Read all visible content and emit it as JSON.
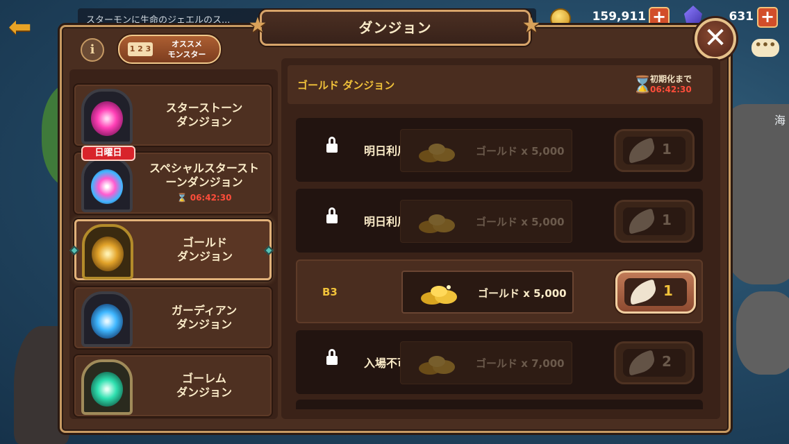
{
  "hud": {
    "marquee": "スターモンに生命のジェエルのス...",
    "gold": "159,911",
    "gems": "631",
    "plus": "+",
    "chat": "•••",
    "back": "⬅"
  },
  "background": {
    "sea_label": "海"
  },
  "dialog": {
    "title": "ダンジョン",
    "close": "✕",
    "info": "i",
    "recommend": {
      "icon_text": "1 2 3",
      "line1": "オススメ",
      "line2": "モンスター"
    }
  },
  "dungeons": [
    {
      "name1": "スターストーン",
      "name2": "ダンジョン",
      "timer": "",
      "badge": "",
      "color": "#ff3fb6"
    },
    {
      "name1": "スペシャルスタースト",
      "name2": "ーンダンジョン",
      "timer": "06:42:30",
      "badge": "日曜日",
      "color": "#ff5bd0"
    },
    {
      "name1": "ゴールド",
      "name2": "ダンジョン",
      "timer": "",
      "badge": "",
      "color": "#e2a32a"
    },
    {
      "name1": "ガーディアン",
      "name2": "ダンジョン",
      "timer": "",
      "badge": "",
      "color": "#3fb7ff"
    },
    {
      "name1": "ゴーレム",
      "name2": "ダンジョン",
      "timer": "",
      "badge": "",
      "color": "#2fe0b0"
    }
  ],
  "section": {
    "title": "ゴールド ダンジョン",
    "reset_label": "初期化まで",
    "reset_time": "06:42:30",
    "hourglass": "⌛"
  },
  "floors": [
    {
      "name": "",
      "status": "明日利用可能",
      "reward": "ゴールド x 5,000",
      "cost": "1",
      "state": "locked"
    },
    {
      "name": "",
      "status": "明日利用可能",
      "reward": "ゴールド x 5,000",
      "cost": "1",
      "state": "locked"
    },
    {
      "name": "B3",
      "status": "",
      "reward": "ゴールド x 5,000",
      "cost": "1",
      "state": "open"
    },
    {
      "name": "",
      "status": "入場不可",
      "reward": "ゴールド x 7,000",
      "cost": "2",
      "state": "locked"
    }
  ],
  "icons": {
    "star": "★"
  }
}
